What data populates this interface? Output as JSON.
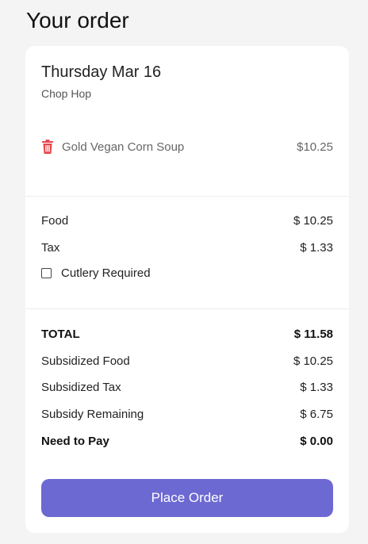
{
  "page": {
    "title": "Your order"
  },
  "order": {
    "date": "Thursday Mar 16",
    "restaurant": "Chop Hop",
    "items": [
      {
        "name": "Gold Vegan Corn Soup",
        "price": "$10.25",
        "icon": "trash-icon"
      }
    ]
  },
  "summary": {
    "food_label": "Food",
    "food_value": "$ 10.25",
    "tax_label": "Tax",
    "tax_value": "$ 1.33",
    "cutlery_label": "Cutlery Required",
    "cutlery_checked": false
  },
  "totals": {
    "total_label": "TOTAL",
    "total_value": "$ 11.58",
    "subsidized_food_label": "Subsidized Food",
    "subsidized_food_value": "$ 10.25",
    "subsidized_tax_label": "Subsidized Tax",
    "subsidized_tax_value": "$ 1.33",
    "subsidy_remaining_label": "Subsidy Remaining",
    "subsidy_remaining_value": "$ 6.75",
    "need_to_pay_label": "Need to Pay",
    "need_to_pay_value": "$ 0.00"
  },
  "actions": {
    "place_order_label": "Place Order"
  },
  "colors": {
    "accent": "#6c69d3",
    "delete": "#e5484d",
    "background": "#f4f4f4",
    "card": "#ffffff"
  }
}
